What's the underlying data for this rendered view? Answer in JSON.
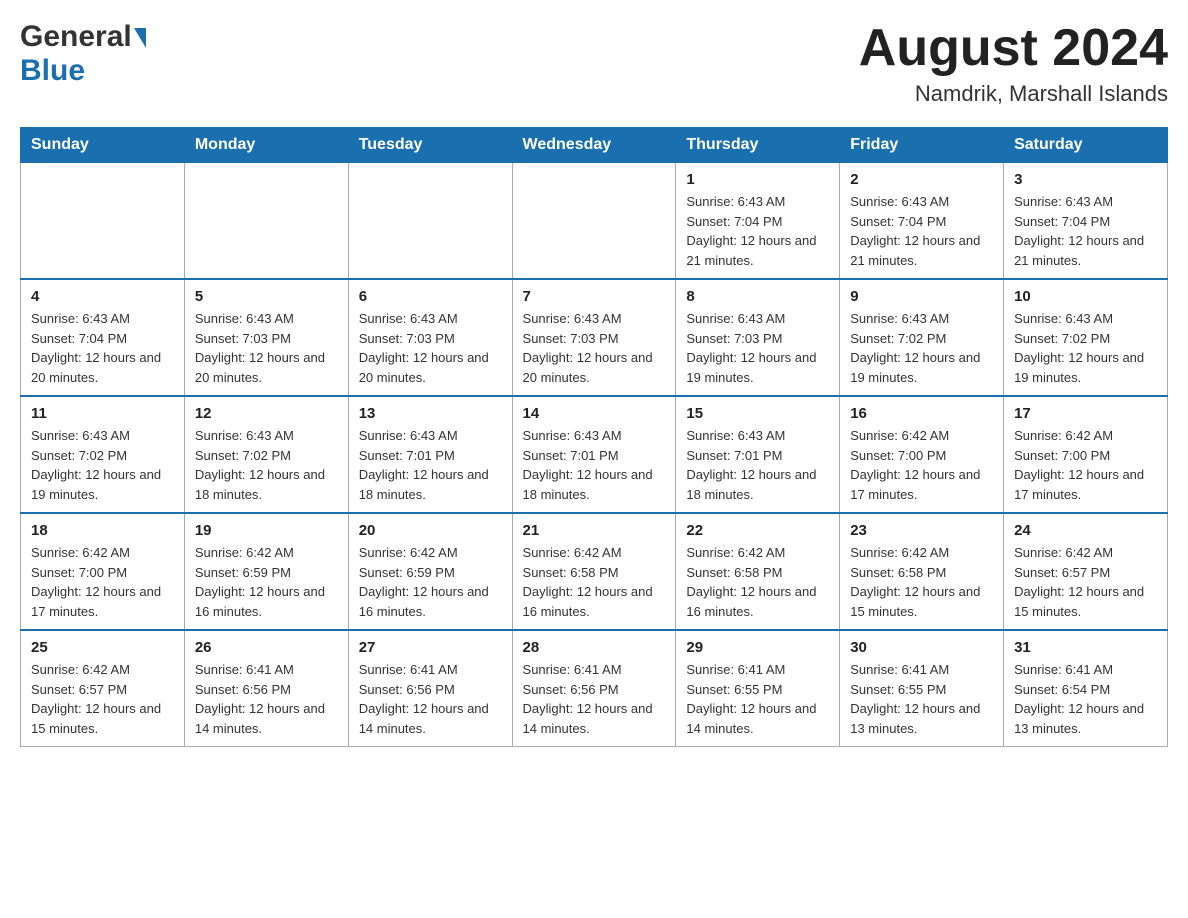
{
  "header": {
    "logo_general": "General",
    "logo_blue": "Blue",
    "month_title": "August 2024",
    "location": "Namdrik, Marshall Islands"
  },
  "calendar": {
    "days_of_week": [
      "Sunday",
      "Monday",
      "Tuesday",
      "Wednesday",
      "Thursday",
      "Friday",
      "Saturday"
    ],
    "weeks": [
      [
        {
          "day": "",
          "sunrise": "",
          "sunset": "",
          "daylight": ""
        },
        {
          "day": "",
          "sunrise": "",
          "sunset": "",
          "daylight": ""
        },
        {
          "day": "",
          "sunrise": "",
          "sunset": "",
          "daylight": ""
        },
        {
          "day": "",
          "sunrise": "",
          "sunset": "",
          "daylight": ""
        },
        {
          "day": "1",
          "sunrise": "Sunrise: 6:43 AM",
          "sunset": "Sunset: 7:04 PM",
          "daylight": "Daylight: 12 hours and 21 minutes."
        },
        {
          "day": "2",
          "sunrise": "Sunrise: 6:43 AM",
          "sunset": "Sunset: 7:04 PM",
          "daylight": "Daylight: 12 hours and 21 minutes."
        },
        {
          "day": "3",
          "sunrise": "Sunrise: 6:43 AM",
          "sunset": "Sunset: 7:04 PM",
          "daylight": "Daylight: 12 hours and 21 minutes."
        }
      ],
      [
        {
          "day": "4",
          "sunrise": "Sunrise: 6:43 AM",
          "sunset": "Sunset: 7:04 PM",
          "daylight": "Daylight: 12 hours and 20 minutes."
        },
        {
          "day": "5",
          "sunrise": "Sunrise: 6:43 AM",
          "sunset": "Sunset: 7:03 PM",
          "daylight": "Daylight: 12 hours and 20 minutes."
        },
        {
          "day": "6",
          "sunrise": "Sunrise: 6:43 AM",
          "sunset": "Sunset: 7:03 PM",
          "daylight": "Daylight: 12 hours and 20 minutes."
        },
        {
          "day": "7",
          "sunrise": "Sunrise: 6:43 AM",
          "sunset": "Sunset: 7:03 PM",
          "daylight": "Daylight: 12 hours and 20 minutes."
        },
        {
          "day": "8",
          "sunrise": "Sunrise: 6:43 AM",
          "sunset": "Sunset: 7:03 PM",
          "daylight": "Daylight: 12 hours and 19 minutes."
        },
        {
          "day": "9",
          "sunrise": "Sunrise: 6:43 AM",
          "sunset": "Sunset: 7:02 PM",
          "daylight": "Daylight: 12 hours and 19 minutes."
        },
        {
          "day": "10",
          "sunrise": "Sunrise: 6:43 AM",
          "sunset": "Sunset: 7:02 PM",
          "daylight": "Daylight: 12 hours and 19 minutes."
        }
      ],
      [
        {
          "day": "11",
          "sunrise": "Sunrise: 6:43 AM",
          "sunset": "Sunset: 7:02 PM",
          "daylight": "Daylight: 12 hours and 19 minutes."
        },
        {
          "day": "12",
          "sunrise": "Sunrise: 6:43 AM",
          "sunset": "Sunset: 7:02 PM",
          "daylight": "Daylight: 12 hours and 18 minutes."
        },
        {
          "day": "13",
          "sunrise": "Sunrise: 6:43 AM",
          "sunset": "Sunset: 7:01 PM",
          "daylight": "Daylight: 12 hours and 18 minutes."
        },
        {
          "day": "14",
          "sunrise": "Sunrise: 6:43 AM",
          "sunset": "Sunset: 7:01 PM",
          "daylight": "Daylight: 12 hours and 18 minutes."
        },
        {
          "day": "15",
          "sunrise": "Sunrise: 6:43 AM",
          "sunset": "Sunset: 7:01 PM",
          "daylight": "Daylight: 12 hours and 18 minutes."
        },
        {
          "day": "16",
          "sunrise": "Sunrise: 6:42 AM",
          "sunset": "Sunset: 7:00 PM",
          "daylight": "Daylight: 12 hours and 17 minutes."
        },
        {
          "day": "17",
          "sunrise": "Sunrise: 6:42 AM",
          "sunset": "Sunset: 7:00 PM",
          "daylight": "Daylight: 12 hours and 17 minutes."
        }
      ],
      [
        {
          "day": "18",
          "sunrise": "Sunrise: 6:42 AM",
          "sunset": "Sunset: 7:00 PM",
          "daylight": "Daylight: 12 hours and 17 minutes."
        },
        {
          "day": "19",
          "sunrise": "Sunrise: 6:42 AM",
          "sunset": "Sunset: 6:59 PM",
          "daylight": "Daylight: 12 hours and 16 minutes."
        },
        {
          "day": "20",
          "sunrise": "Sunrise: 6:42 AM",
          "sunset": "Sunset: 6:59 PM",
          "daylight": "Daylight: 12 hours and 16 minutes."
        },
        {
          "day": "21",
          "sunrise": "Sunrise: 6:42 AM",
          "sunset": "Sunset: 6:58 PM",
          "daylight": "Daylight: 12 hours and 16 minutes."
        },
        {
          "day": "22",
          "sunrise": "Sunrise: 6:42 AM",
          "sunset": "Sunset: 6:58 PM",
          "daylight": "Daylight: 12 hours and 16 minutes."
        },
        {
          "day": "23",
          "sunrise": "Sunrise: 6:42 AM",
          "sunset": "Sunset: 6:58 PM",
          "daylight": "Daylight: 12 hours and 15 minutes."
        },
        {
          "day": "24",
          "sunrise": "Sunrise: 6:42 AM",
          "sunset": "Sunset: 6:57 PM",
          "daylight": "Daylight: 12 hours and 15 minutes."
        }
      ],
      [
        {
          "day": "25",
          "sunrise": "Sunrise: 6:42 AM",
          "sunset": "Sunset: 6:57 PM",
          "daylight": "Daylight: 12 hours and 15 minutes."
        },
        {
          "day": "26",
          "sunrise": "Sunrise: 6:41 AM",
          "sunset": "Sunset: 6:56 PM",
          "daylight": "Daylight: 12 hours and 14 minutes."
        },
        {
          "day": "27",
          "sunrise": "Sunrise: 6:41 AM",
          "sunset": "Sunset: 6:56 PM",
          "daylight": "Daylight: 12 hours and 14 minutes."
        },
        {
          "day": "28",
          "sunrise": "Sunrise: 6:41 AM",
          "sunset": "Sunset: 6:56 PM",
          "daylight": "Daylight: 12 hours and 14 minutes."
        },
        {
          "day": "29",
          "sunrise": "Sunrise: 6:41 AM",
          "sunset": "Sunset: 6:55 PM",
          "daylight": "Daylight: 12 hours and 14 minutes."
        },
        {
          "day": "30",
          "sunrise": "Sunrise: 6:41 AM",
          "sunset": "Sunset: 6:55 PM",
          "daylight": "Daylight: 12 hours and 13 minutes."
        },
        {
          "day": "31",
          "sunrise": "Sunrise: 6:41 AM",
          "sunset": "Sunset: 6:54 PM",
          "daylight": "Daylight: 12 hours and 13 minutes."
        }
      ]
    ]
  }
}
